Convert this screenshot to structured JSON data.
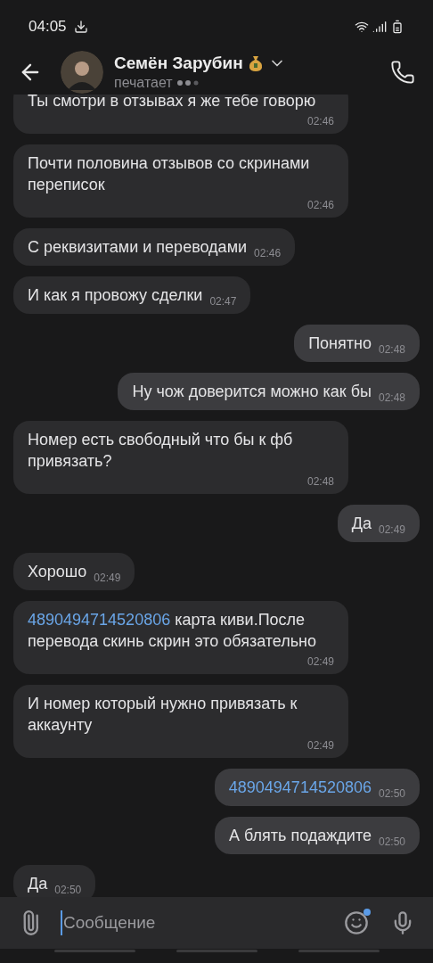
{
  "status_bar": {
    "time": "04:05"
  },
  "header": {
    "name": "Семён Зарубин",
    "status": "печатает"
  },
  "messages": [
    {
      "kind": "text",
      "outgoing": false,
      "text": "Ты смотри в отзывах я же тебе говорю",
      "time": "02:46"
    },
    {
      "kind": "text",
      "outgoing": false,
      "text": "Почти половина отзывов со скринами переписок",
      "time": "02:46"
    },
    {
      "kind": "text",
      "outgoing": false,
      "text": "С реквизитами и переводами",
      "time": "02:46"
    },
    {
      "kind": "text",
      "outgoing": false,
      "text": "И как я провожу сделки",
      "time": "02:47"
    },
    {
      "kind": "text",
      "outgoing": true,
      "text": "Понятно",
      "time": "02:48"
    },
    {
      "kind": "text",
      "outgoing": true,
      "text": "Ну чож доверится можно как бы",
      "time": "02:48"
    },
    {
      "kind": "text",
      "outgoing": false,
      "text": "Номер есть свободный что бы к фб привязать?",
      "time": "02:48"
    },
    {
      "kind": "text",
      "outgoing": true,
      "text": "Да",
      "time": "02:49"
    },
    {
      "kind": "text",
      "outgoing": false,
      "text": "Хорошо",
      "time": "02:49"
    },
    {
      "kind": "link",
      "outgoing": false,
      "link": "4890494714520806",
      "text": "карта киви.После перевода скинь скрин это обязательно",
      "time": "02:49"
    },
    {
      "kind": "text",
      "outgoing": false,
      "text": "И номер который нужно привязать к аккаунту",
      "time": "02:49"
    },
    {
      "kind": "link",
      "outgoing": true,
      "link": "4890494714520806",
      "time": "02:50"
    },
    {
      "kind": "text",
      "outgoing": true,
      "text": "А блять подаждите",
      "time": "02:50"
    },
    {
      "kind": "text",
      "outgoing": false,
      "text": "Да",
      "time": "02:50"
    }
  ],
  "composer": {
    "placeholder": "Сообщение"
  }
}
